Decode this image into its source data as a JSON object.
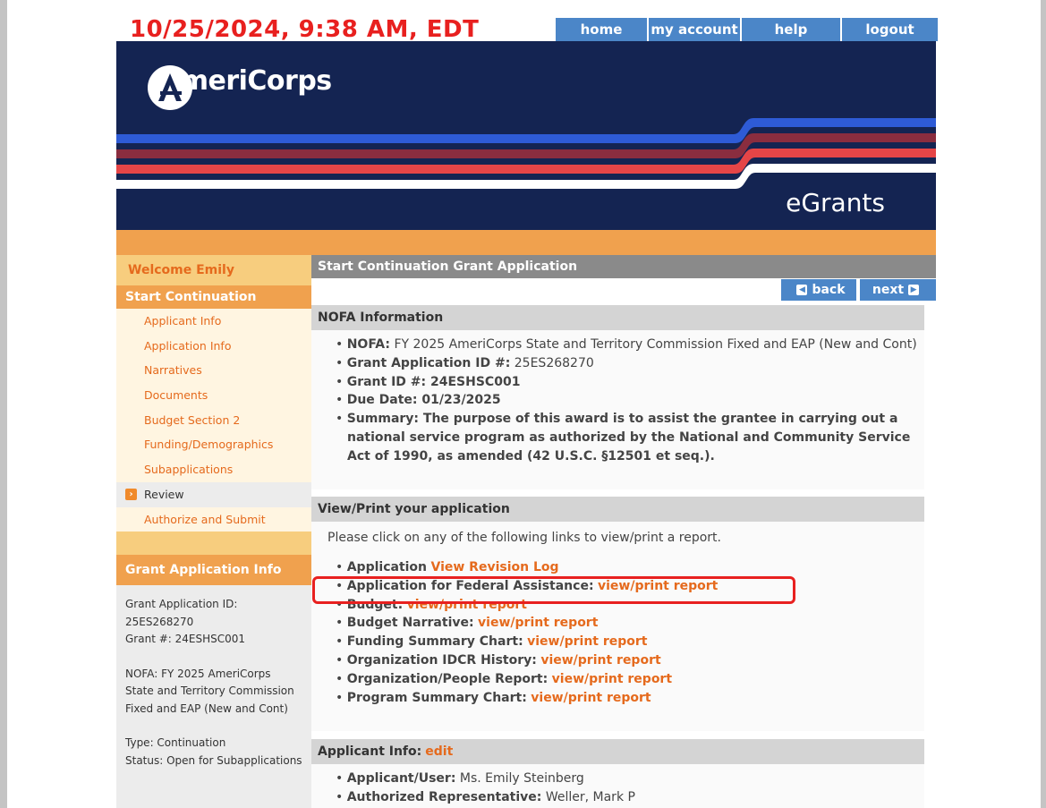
{
  "header": {
    "datetime": "10/25/2024, 9:38 AM, EDT",
    "nav": [
      "home",
      "my account",
      "help",
      "logout"
    ],
    "logo_text": "AmeriCorps",
    "product": "eGrants"
  },
  "sidebar": {
    "welcome": "Welcome Emily",
    "section_title": "Start Continuation",
    "items": [
      {
        "label": "Applicant Info"
      },
      {
        "label": "Application Info"
      },
      {
        "label": "Narratives"
      },
      {
        "label": "Documents"
      },
      {
        "label": "Budget Section 2"
      },
      {
        "label": "Funding/Demographics"
      },
      {
        "label": "Subapplications"
      },
      {
        "label": "Review",
        "current": true
      },
      {
        "label": "Authorize and Submit"
      }
    ],
    "info_title": "Grant Application Info",
    "info": {
      "app_id_label": "Grant Application ID:",
      "app_id": "25ES268270",
      "grant": "Grant #: 24ESHSC001",
      "nofa": "NOFA: FY 2025 AmeriCorps State and Territory Commission Fixed and EAP (New and Cont)",
      "type": "Type: Continuation",
      "status": "Status: Open for Subapplications"
    }
  },
  "main": {
    "title": "Start Continuation Grant Application",
    "back": "back",
    "next": "next",
    "nofa_section": {
      "title": "NOFA Information",
      "nofa_label": "NOFA:",
      "nofa_value": "FY 2025 AmeriCorps State and Territory Commission Fixed and EAP (New and Cont)",
      "app_id_label": "Grant Application ID #:",
      "app_id_value": "25ES268270",
      "grant_id": "Grant ID #: 24ESHSC001",
      "due_date": "Due Date: 01/23/2025",
      "summary": "Summary: The purpose of this award is to assist the grantee in carrying out a national service program as authorized by the National and Community Service Act of 1990, as amended (42 U.S.C. §12501 et seq.)."
    },
    "print_section": {
      "title": "View/Print your application",
      "intro": "Please click on any of the following links to view/print a report.",
      "items": [
        {
          "label": "Application",
          "link": "View Revision Log"
        },
        {
          "label": "Application for Federal Assistance:",
          "link": "view/print report"
        },
        {
          "label": "Budget:",
          "link": "view/print report"
        },
        {
          "label": "Budget Narrative:",
          "link": "view/print report"
        },
        {
          "label": "Funding Summary Chart:",
          "link": "view/print report"
        },
        {
          "label": "Organization IDCR History:",
          "link": "view/print report"
        },
        {
          "label": "Organization/People Report:",
          "link": "view/print report"
        },
        {
          "label": "Program Summary Chart:",
          "link": "view/print report"
        }
      ]
    },
    "applicant_section": {
      "title": "Applicant Info:",
      "edit": "edit",
      "user_label": "Applicant/User:",
      "user_value": "Ms. Emily Steinberg",
      "rep_label": "Authorized Representative:",
      "rep_value": "Weller, Mark P"
    }
  },
  "colors": {
    "navy": "#142452",
    "orange": "#f0a14e",
    "link_orange": "#e56a1d",
    "blue": "#4b86c8",
    "red": "#e8201f"
  }
}
